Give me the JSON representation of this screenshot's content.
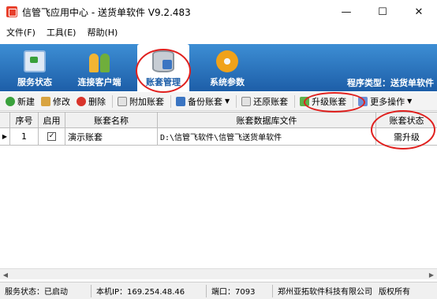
{
  "window": {
    "title": "信管飞应用中心 - 送货单软件 V9.2.483",
    "minimize": "—",
    "maximize": "☐",
    "close": "✕"
  },
  "menu": [
    "文件(F)",
    "工具(E)",
    "帮助(H)"
  ],
  "nav": {
    "tabs": [
      {
        "label": "服务状态",
        "icon": "monitor-icon"
      },
      {
        "label": "连接客户端",
        "icon": "users-icon"
      },
      {
        "label": "账套管理",
        "icon": "database-icon",
        "active": true
      },
      {
        "label": "系统参数",
        "icon": "gear-icon"
      }
    ],
    "program_type": "程序类型：送货单软件"
  },
  "toolbar": {
    "new": "新建",
    "edit": "修改",
    "delete": "删除",
    "attach": "附加账套",
    "backup": "备份账套",
    "restore": "还原账套",
    "upgrade": "升级账套",
    "more": "更多操作"
  },
  "grid": {
    "columns": [
      "序号",
      "启用",
      "账套名称",
      "账套数据库文件",
      "账套状态"
    ],
    "rows": [
      {
        "index": "1",
        "enabled": true,
        "name": "演示账套",
        "db_file": "D:\\信管飞软件\\信管飞送货单软件",
        "status": "需升级"
      }
    ]
  },
  "status_bar": {
    "service": "服务状态：已启动",
    "ip": "本机IP：169.254.48.46",
    "port": "端口：7093",
    "company": "郑州亚拓软件科技有限公司",
    "copyright": "版权所有"
  },
  "annotation_color": "#e0201e"
}
